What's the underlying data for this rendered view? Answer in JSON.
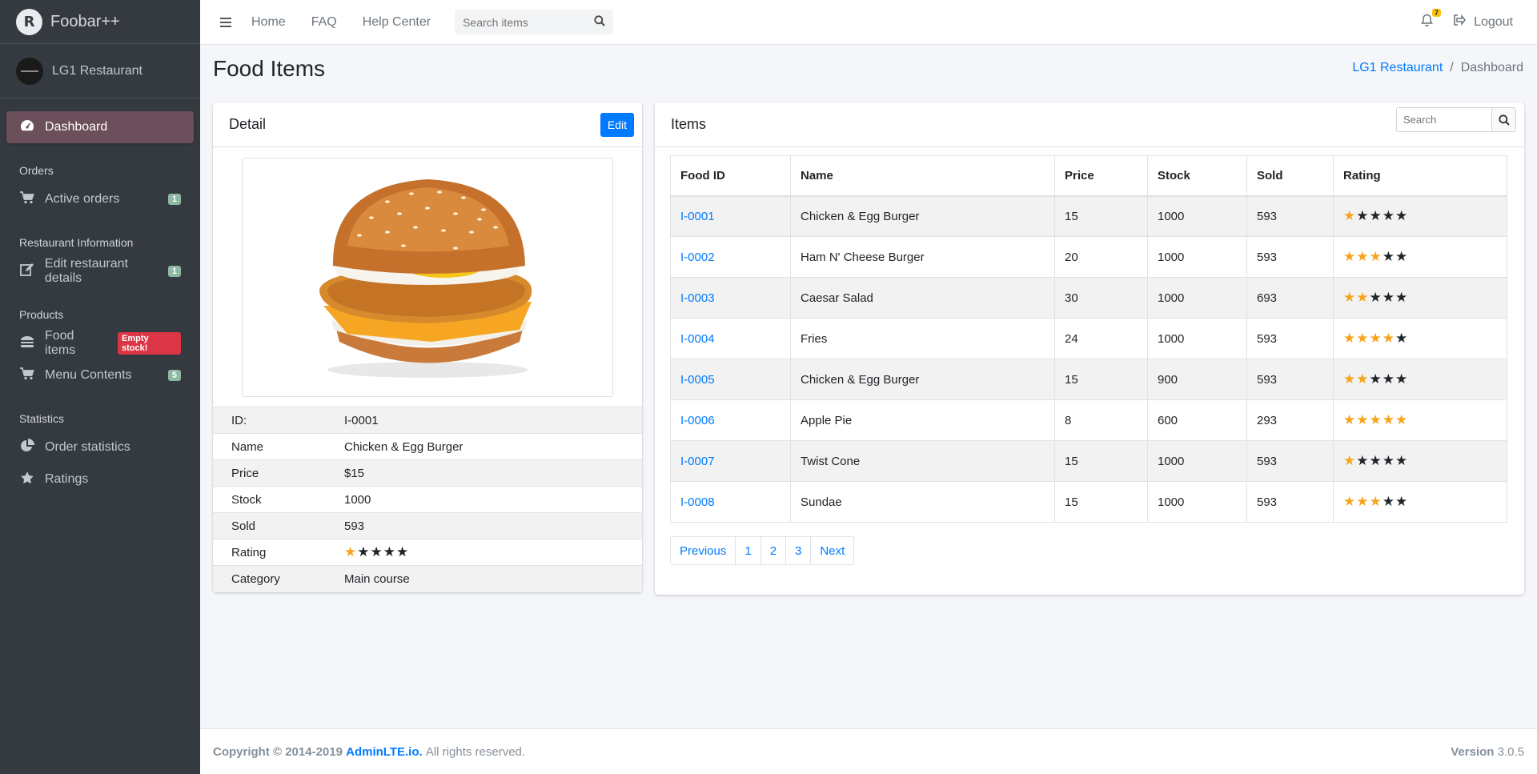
{
  "brand": {
    "name": "Foobar++",
    "logo_letter": "R"
  },
  "user": {
    "name": "LG1 Restaurant"
  },
  "sidebar": {
    "dashboard": "Dashboard",
    "sections": [
      {
        "header": "Orders",
        "items": [
          {
            "label": "Active orders",
            "icon": "shopping-cart-icon",
            "badge": "1"
          }
        ]
      },
      {
        "header": "Restaurant Information",
        "items": [
          {
            "label": "Edit restaurant details",
            "icon": "edit-icon",
            "badge": "1"
          }
        ]
      },
      {
        "header": "Products",
        "items": [
          {
            "label": "Food items",
            "icon": "hamburger-icon",
            "badge_alert": "Empty stock!"
          },
          {
            "label": "Menu Contents",
            "icon": "shopping-cart-icon",
            "badge": "5"
          }
        ]
      },
      {
        "header": "Statistics",
        "items": [
          {
            "label": "Order statistics",
            "icon": "pie-chart-icon"
          },
          {
            "label": "Ratings",
            "icon": "star-icon"
          }
        ]
      }
    ]
  },
  "navbar": {
    "links": [
      "Home",
      "FAQ",
      "Help Center"
    ],
    "search_placeholder": "Search items",
    "notifications": "7",
    "logout": "Logout"
  },
  "page": {
    "title": "Food Items",
    "breadcrumb": [
      "LG1 Restaurant",
      "Dashboard"
    ]
  },
  "detail": {
    "title": "Detail",
    "edit_label": "Edit",
    "image_alt": "burger",
    "fields": [
      {
        "label": "ID:",
        "value": "I-0001"
      },
      {
        "label": "Name",
        "value": "Chicken & Egg Burger"
      },
      {
        "label": "Price",
        "value": "$15"
      },
      {
        "label": "Stock",
        "value": "1000"
      },
      {
        "label": "Sold",
        "value": "593"
      },
      {
        "label": "Rating",
        "rating": 1
      },
      {
        "label": "Category",
        "value": "Main course"
      }
    ]
  },
  "items": {
    "title": "Items",
    "search_placeholder": "Search",
    "columns": [
      "Food ID",
      "Name",
      "Price",
      "Stock",
      "Sold",
      "Rating"
    ],
    "rows": [
      {
        "id": "I-0001",
        "name": "Chicken & Egg Burger",
        "price": "15",
        "stock": "1000",
        "sold": "593",
        "rating": 1
      },
      {
        "id": "I-0002",
        "name": "Ham N' Cheese Burger",
        "price": "20",
        "stock": "1000",
        "sold": "593",
        "rating": 3
      },
      {
        "id": "I-0003",
        "name": "Caesar Salad",
        "price": "30",
        "stock": "1000",
        "sold": "693",
        "rating": 2
      },
      {
        "id": "I-0004",
        "name": "Fries",
        "price": "24",
        "stock": "1000",
        "sold": "593",
        "rating": 4
      },
      {
        "id": "I-0005",
        "name": "Chicken & Egg Burger",
        "price": "15",
        "stock": "900",
        "sold": "593",
        "rating": 2
      },
      {
        "id": "I-0006",
        "name": "Apple Pie",
        "price": "8",
        "stock": "600",
        "sold": "293",
        "rating": 5
      },
      {
        "id": "I-0007",
        "name": "Twist Cone",
        "price": "15",
        "stock": "1000",
        "sold": "593",
        "rating": 1
      },
      {
        "id": "I-0008",
        "name": "Sundae",
        "price": "15",
        "stock": "1000",
        "sold": "593",
        "rating": 3
      }
    ],
    "pagination": [
      "Previous",
      "1",
      "2",
      "3",
      "Next"
    ],
    "max_rating": 5
  },
  "footer": {
    "copyright": "Copyright © 2014-2019",
    "link": "AdminLTE.io.",
    "rights": "All rights reserved.",
    "version_label": "Version",
    "version": "3.0.5"
  },
  "colors": {
    "sidebar_bg": "#343a40",
    "active_item": "#6b4f5b",
    "primary": "#007bff",
    "star_on": "#f7a41d",
    "danger": "#dc3545"
  }
}
